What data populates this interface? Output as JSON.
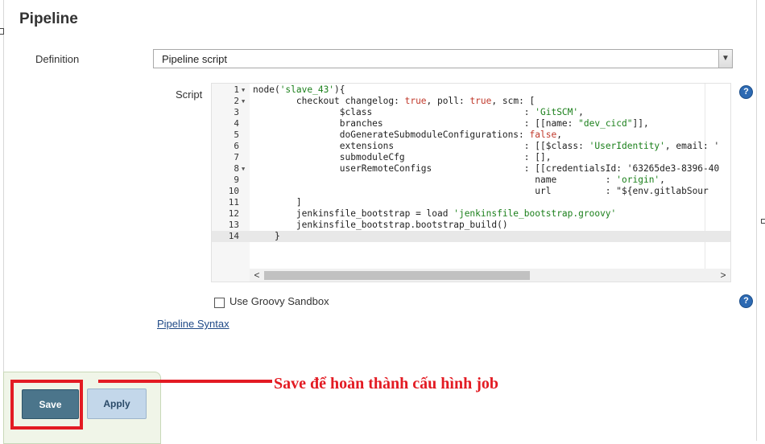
{
  "section": {
    "title": "Pipeline"
  },
  "definition": {
    "label": "Definition",
    "value": "Pipeline script"
  },
  "script": {
    "label": "Script",
    "lines": [
      {
        "n": "1",
        "fold": true,
        "text": "node('slave_43'){"
      },
      {
        "n": "2",
        "fold": true,
        "text": "        checkout changelog: true, poll: true, scm: ["
      },
      {
        "n": "3",
        "fold": false,
        "text": "                $class                            : 'GitSCM',"
      },
      {
        "n": "4",
        "fold": false,
        "text": "                branches                          : [[name: \"dev_cicd\"]],"
      },
      {
        "n": "5",
        "fold": false,
        "text": "                doGenerateSubmoduleConfigurations: false,"
      },
      {
        "n": "6",
        "fold": false,
        "text": "                extensions                        : [[$class: 'UserIdentity', email: '"
      },
      {
        "n": "7",
        "fold": false,
        "text": "                submoduleCfg                      : [],"
      },
      {
        "n": "8",
        "fold": true,
        "text": "                userRemoteConfigs                 : [[credentialsId: '63265de3-8396-40"
      },
      {
        "n": "9",
        "fold": false,
        "text": "                                                    name         : 'origin',"
      },
      {
        "n": "10",
        "fold": false,
        "text": "                                                    url          : \"${env.gitlabSour"
      },
      {
        "n": "11",
        "fold": false,
        "text": "        ]"
      },
      {
        "n": "12",
        "fold": false,
        "text": "        jenkinsfile_bootstrap = load 'jenkinsfile_bootstrap.groovy'"
      },
      {
        "n": "13",
        "fold": false,
        "text": "        jenkinsfile_bootstrap.bootstrap_build()"
      },
      {
        "n": "14",
        "fold": false,
        "text": "    }"
      }
    ],
    "active_line": "14",
    "scroll_left_arrow": "<",
    "scroll_right_arrow": ">"
  },
  "sandbox": {
    "label": "Use Groovy Sandbox",
    "checked": false
  },
  "help_icon": "?",
  "pipeline_syntax_link": "Pipeline Syntax",
  "buttons": {
    "save": "Save",
    "apply": "Apply"
  },
  "annotation": {
    "text": "Save để hoàn thành cấu hình job",
    "color": "#e31b23"
  },
  "colors": {
    "save_button": "#4b758b",
    "apply_button": "#c3d7ea",
    "link": "#204a87",
    "help_icon": "#2d6ab3"
  }
}
